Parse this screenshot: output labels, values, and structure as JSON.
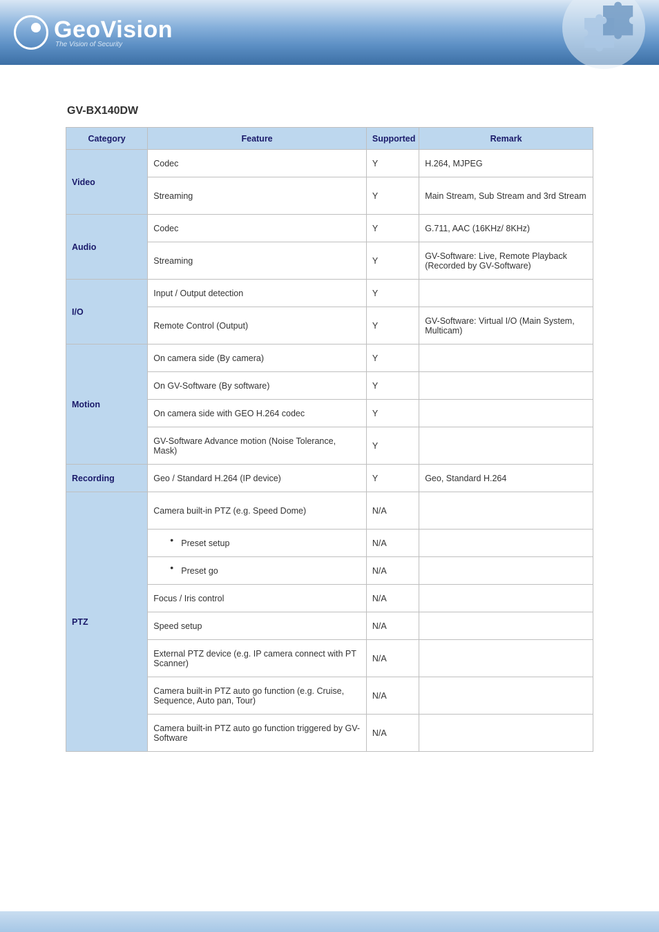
{
  "brand": {
    "name": "GeoVision",
    "tagline": "The Vision of Security"
  },
  "section_heading": "GV-BX140DW",
  "table": {
    "headers": [
      "Category",
      "Feature",
      "Supported",
      "Remark"
    ],
    "groups": [
      {
        "category": "Video",
        "rows": [
          {
            "feature": "Codec",
            "supported": "Y",
            "remark": "H.264, MJPEG"
          },
          {
            "feature": "Streaming",
            "supported": "Y",
            "remark": "Main Stream, Sub Stream and 3rd Stream"
          }
        ]
      },
      {
        "category": "Audio",
        "rows": [
          {
            "feature": "Codec",
            "supported": "Y",
            "remark": "G.711, AAC (16KHz/ 8KHz)"
          },
          {
            "feature": "Streaming",
            "supported": "Y",
            "remark": "GV-Software: Live, Remote Playback (Recorded by GV-Software)"
          }
        ]
      },
      {
        "category": "I/O",
        "rows": [
          {
            "feature": "Input / Output detection",
            "supported": "Y",
            "remark": ""
          },
          {
            "feature": "Remote Control (Output)",
            "supported": "Y",
            "remark": "GV-Software: Virtual I/O (Main System, Multicam)"
          }
        ]
      },
      {
        "category": "Motion",
        "rows": [
          {
            "feature": "On camera side (By camera)",
            "supported": "Y",
            "remark": ""
          },
          {
            "feature": "On GV-Software (By software)",
            "supported": "Y",
            "remark": ""
          },
          {
            "feature": "On camera side with GEO H.264 codec",
            "supported": "Y",
            "remark": ""
          },
          {
            "feature": "GV-Software Advance motion (Noise Tolerance, Mask)",
            "supported": "Y",
            "remark": ""
          }
        ]
      },
      {
        "category": "Recording",
        "rows": [
          {
            "feature": "Geo / Standard H.264 (IP device)",
            "supported": "Y",
            "remark": "Geo, Standard H.264"
          }
        ]
      },
      {
        "category": "PTZ",
        "rows": [
          {
            "feature": "Camera built-in PTZ (e.g. Speed Dome)",
            "supported": "N/A",
            "remark": ""
          },
          {
            "feature": "Preset setup",
            "supported": "N/A",
            "remark": "",
            "subtype": "bullet"
          },
          {
            "feature": "Preset go",
            "supported": "N/A",
            "remark": "",
            "subtype": "bullet"
          },
          {
            "feature": "Focus / Iris control",
            "supported": "N/A",
            "remark": ""
          },
          {
            "feature": "Speed setup",
            "supported": "N/A",
            "remark": ""
          },
          {
            "feature": "External PTZ device (e.g. IP camera connect with PT Scanner)",
            "supported": "N/A",
            "remark": ""
          },
          {
            "feature": "Camera built-in PTZ auto go function (e.g. Cruise, Sequence, Auto pan, Tour)",
            "supported": "N/A",
            "remark": ""
          },
          {
            "feature": "Camera built-in PTZ auto go function triggered by GV-Software",
            "supported": "N/A",
            "remark": ""
          }
        ]
      }
    ]
  }
}
